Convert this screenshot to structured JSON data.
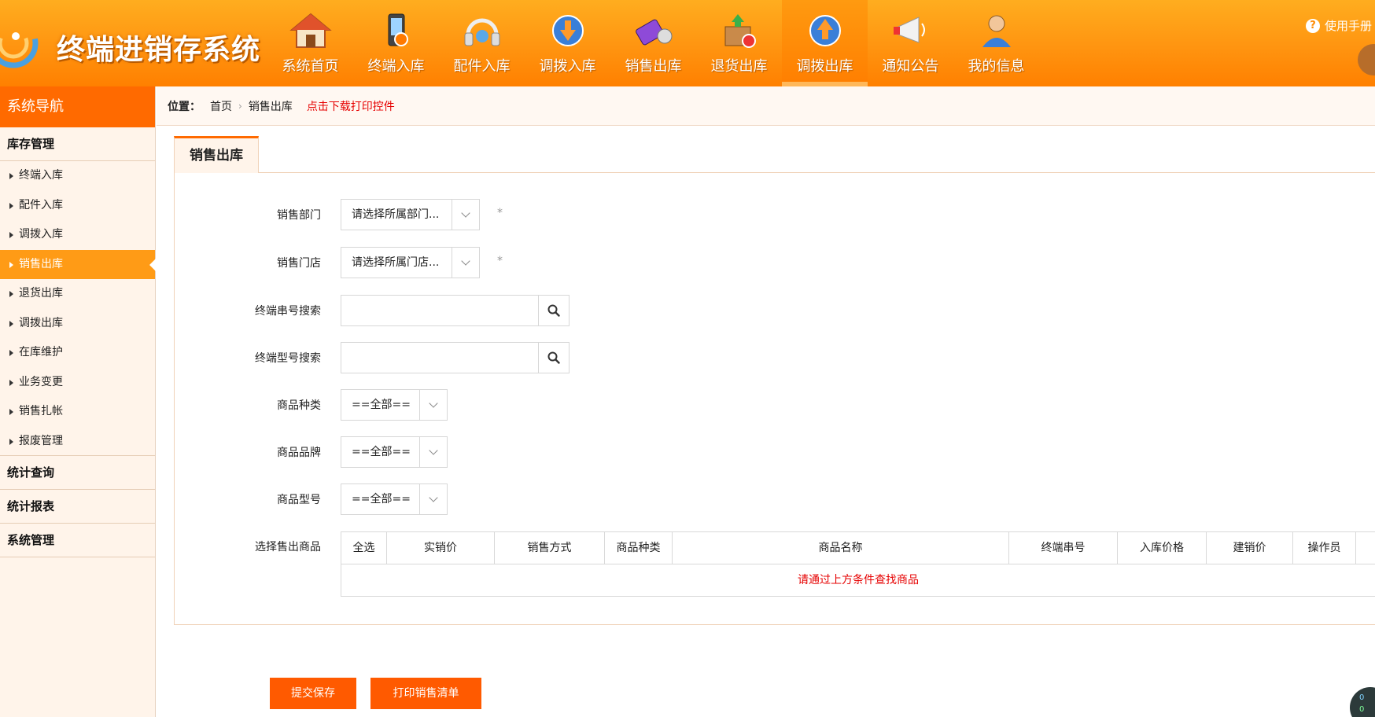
{
  "app": {
    "title": "终端进销存系统"
  },
  "nav": [
    {
      "label": "系统首页",
      "icon": "house-icon"
    },
    {
      "label": "终端入库",
      "icon": "phone-in-icon"
    },
    {
      "label": "配件入库",
      "icon": "headset-icon"
    },
    {
      "label": "调拨入库",
      "icon": "transfer-in-icon"
    },
    {
      "label": "销售出库",
      "icon": "sales-out-icon"
    },
    {
      "label": "退货出库",
      "icon": "return-box-icon"
    },
    {
      "label": "调拨出库",
      "icon": "transfer-out-icon",
      "active": true
    },
    {
      "label": "通知公告",
      "icon": "megaphone-icon"
    },
    {
      "label": "我的信息",
      "icon": "user-icon"
    }
  ],
  "help": {
    "label": "使用手册"
  },
  "sidebar": {
    "title": "系统导航",
    "groups": [
      {
        "label": "库存管理"
      },
      {
        "label": "统计查询"
      },
      {
        "label": "统计报表"
      },
      {
        "label": "系统管理"
      }
    ],
    "items": [
      {
        "label": "终端入库"
      },
      {
        "label": "配件入库"
      },
      {
        "label": "调拨入库"
      },
      {
        "label": "销售出库",
        "active": true
      },
      {
        "label": "退货出库"
      },
      {
        "label": "调拨出库"
      },
      {
        "label": "在库维护"
      },
      {
        "label": "业务变更"
      },
      {
        "label": "销售扎帐"
      },
      {
        "label": "报废管理"
      }
    ]
  },
  "breadcrumb": {
    "label": "位置：",
    "home": "首页",
    "current": "销售出库",
    "download": "点击下载打印控件"
  },
  "panel": {
    "tab": "销售出库"
  },
  "form": {
    "dept": {
      "label": "销售部门",
      "value": "请选择所属部门...",
      "required": "*"
    },
    "store": {
      "label": "销售门店",
      "value": "请选择所属门店...",
      "required": "*"
    },
    "serial": {
      "label": "终端串号搜索",
      "value": ""
    },
    "model": {
      "label": "终端型号搜索",
      "value": ""
    },
    "category": {
      "label": "商品种类",
      "value": "==全部=="
    },
    "brand": {
      "label": "商品品牌",
      "value": "==全部=="
    },
    "goods_model": {
      "label": "商品型号",
      "value": "==全部=="
    },
    "select_goods": {
      "label": "选择售出商品"
    }
  },
  "table": {
    "columns": [
      "全选",
      "实销价",
      "销售方式",
      "商品种类",
      "商品名称",
      "终端串号",
      "入库价格",
      "建销价",
      "操作员"
    ],
    "empty": "请通过上方条件查找商品"
  },
  "buttons": {
    "submit": "提交保存",
    "print": "打印销售清单"
  },
  "float_widget": {
    "top": "0",
    "bottom": "0"
  },
  "colors": {
    "header": "#ff9410",
    "accent": "#ff6a00",
    "active_item": "#ff9b16",
    "button": "#ff5a00",
    "alert_text": "#e60000"
  }
}
